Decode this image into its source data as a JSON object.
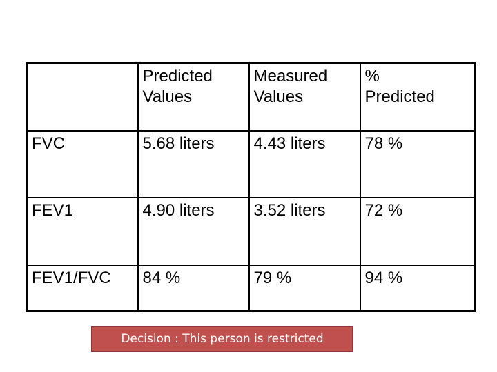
{
  "table": {
    "headers": [
      "",
      "Predicted\nValues",
      "Measured\nValues",
      "%\nPredicted"
    ],
    "header_lines": [
      [],
      [
        "Predicted",
        "Values"
      ],
      [
        "Measured",
        "Values"
      ],
      [
        "%",
        "Predicted"
      ]
    ],
    "rows": [
      {
        "label": "FVC",
        "predicted": "5.68 liters",
        "measured": "4.43 liters",
        "percent_predicted": "78 %"
      },
      {
        "label": "FEV1",
        "predicted": "4.90 liters",
        "measured": "3.52 liters",
        "percent_predicted": "72 %"
      },
      {
        "label": "FEV1/FVC",
        "predicted": "84 %",
        "measured": "79 %",
        "percent_predicted": "94 %"
      }
    ]
  },
  "decision": {
    "text": "Decision : This person is restricted",
    "color": "#c0504d"
  }
}
